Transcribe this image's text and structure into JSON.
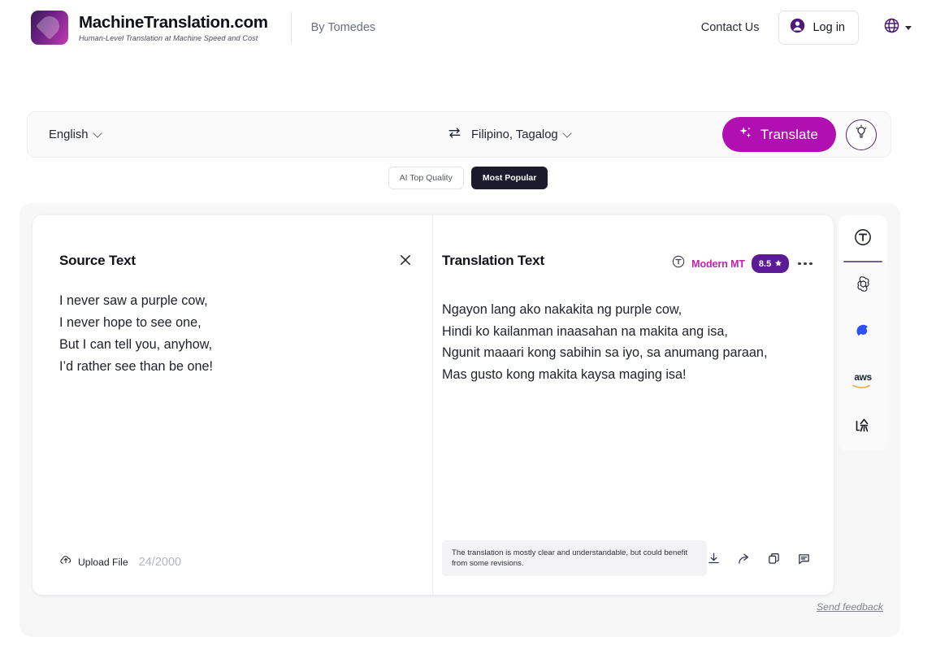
{
  "header": {
    "brand_title": "MachineTranslation.com",
    "brand_tagline": "Human-Level Translation at Machine Speed and Cost",
    "by_line": "By Tomedes",
    "contact_label": "Contact Us",
    "login_label": "Log in",
    "logo_icon": "machinetranslation-logo",
    "user_icon": "user-circle-icon",
    "globe_icon": "globe-icon",
    "caret_icon": "chevron-down-icon"
  },
  "language_bar": {
    "source_language": "English",
    "target_language": "Filipino, Tagalog",
    "swap_icon": "swap-arrows-icon",
    "translate_label": "Translate",
    "translate_icon": "sparkle-icon",
    "translate_color": "#b20fb2",
    "bulb_icon": "lightbulb-idea-icon"
  },
  "mode_pills": [
    {
      "label": "AI Top Quality",
      "active": false
    },
    {
      "label": "Most Popular",
      "active": true
    }
  ],
  "source_panel": {
    "title": "Source Text",
    "close_icon": "close-icon",
    "text": "I never saw a purple cow,\nI never hope to see one,\nBut I can tell you, anyhow,\nI’d rather see than be one!",
    "upload_label": "Upload File",
    "upload_icon": "cloud-upload-icon",
    "char_count": "24/2000"
  },
  "translation_panel": {
    "title": "Translation Text",
    "engine_name": "Modern MT",
    "engine_icon": "modernmt-circle-t-icon",
    "engine_color": "#c51fb5",
    "score": "8.5",
    "score_icon": "star-icon",
    "score_badge_color": "#5b1a96",
    "more_icon": "more-options-icon",
    "text": "Ngayon lang ako nakakita ng purple cow,\nHindi ko kailanman inaasahan na makita ang isa,\nNgunit maaari kong sabihin sa iyo, sa anumang paraan,\nMas gusto kong makita kaysa maging isa!",
    "quality_note": "The translation is mostly clear and understandable, but could benefit from some revisions.",
    "actions": [
      {
        "icon": "download-icon",
        "name": "download-button"
      },
      {
        "icon": "share-icon",
        "name": "share-button"
      },
      {
        "icon": "copy-icon",
        "name": "copy-button"
      },
      {
        "icon": "comment-icon",
        "name": "comment-button"
      }
    ]
  },
  "engine_sidebar": [
    {
      "name": "Modern MT",
      "icon": "modernmt-icon",
      "selected": true
    },
    {
      "name": "OpenAI",
      "icon": "openai-icon",
      "selected": false
    },
    {
      "name": "Google Gemini",
      "icon": "gemini-icon",
      "selected": false
    },
    {
      "name": "AWS",
      "icon": "aws-icon",
      "label": "aws",
      "selected": false
    },
    {
      "name": "Baidu",
      "icon": "baidu-icon",
      "selected": false
    }
  ],
  "footer": {
    "send_feedback": "Send feedback"
  }
}
